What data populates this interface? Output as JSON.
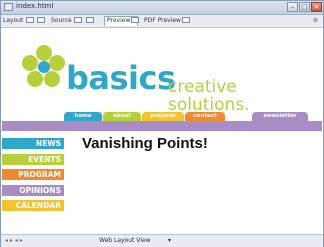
{
  "window": {
    "title": "index.html"
  },
  "toolbar": {
    "layout_label": "Layout",
    "source_label": "Source",
    "preview_label": "Preview",
    "pdf_preview_label": "PDF Preview"
  },
  "site": {
    "logo_word": "basics",
    "logo_tagline": "creative solutions.",
    "nav": [
      "home",
      "about",
      "projects",
      "contact",
      "newsletter"
    ],
    "sidebar": [
      "NEWS",
      "EVENTS",
      "PROGRAM",
      "OPINIONS",
      "CALENDAR"
    ],
    "headline": "Vanishing Points!"
  },
  "status": {
    "view_mode": "Web Layout View"
  },
  "colors": {
    "cyan": "#2fa7c7",
    "lime": "#b7cf3a",
    "orange": "#f08a2c",
    "purple": "#a78dc4",
    "yellow": "#f2c230"
  }
}
